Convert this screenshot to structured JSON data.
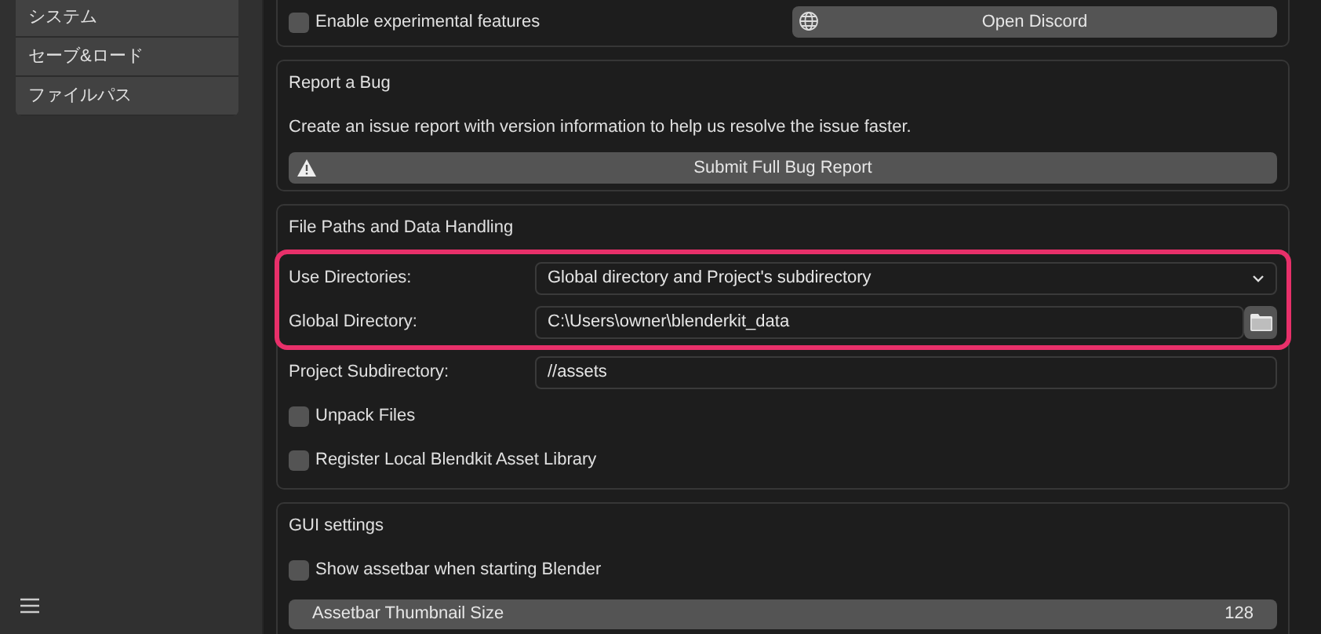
{
  "sidebar": {
    "items": [
      {
        "label": "システム",
        "selected": false
      },
      {
        "label": "セーブ&ロード",
        "selected": false
      },
      {
        "label": "ファイルパス",
        "selected": false
      }
    ]
  },
  "experimental": {
    "label": "Enable experimental features",
    "checked": false,
    "button": "Open Discord"
  },
  "report_bug": {
    "title": "Report a Bug",
    "description": "Create an issue report with version information to help us resolve the issue faster.",
    "button": "Submit Full Bug Report"
  },
  "file_paths": {
    "title": "File Paths and Data Handling",
    "rows": [
      {
        "kind": "dropdown",
        "label": "Use Directories:",
        "value": "Global directory and Project's subdirectory",
        "highlighted": true
      },
      {
        "kind": "path",
        "label": "Global Directory:",
        "value": "C:\\Users\\owner\\blenderkit_data",
        "highlighted": true
      },
      {
        "kind": "text",
        "label": "Project Subdirectory:",
        "value": "//assets",
        "highlighted": false
      },
      {
        "kind": "checkbox",
        "label": "Unpack Files",
        "checked": false,
        "highlighted": false
      },
      {
        "kind": "checkbox",
        "label": "Register Local Blendkit Asset Library",
        "checked": false,
        "highlighted": false
      }
    ]
  },
  "gui_settings": {
    "title": "GUI settings",
    "rows": [
      {
        "kind": "checkbox",
        "label": "Show assetbar when starting Blender",
        "checked": false
      },
      {
        "kind": "number",
        "label": "Assetbar Thumbnail Size",
        "value": "128"
      }
    ]
  }
}
